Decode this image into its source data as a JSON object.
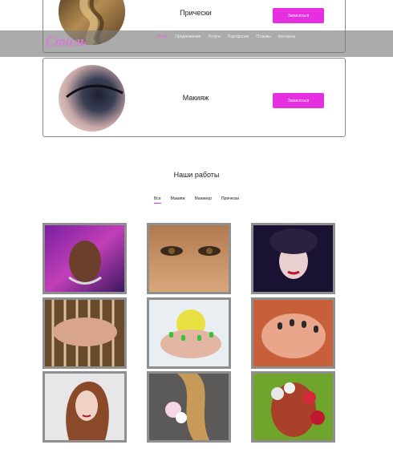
{
  "cards": [
    {
      "title": "Прически",
      "button": "Записаться"
    },
    {
      "title": "Макияж",
      "button": "Записаться"
    }
  ],
  "header": {
    "logo": "Стиль",
    "nav": [
      {
        "label": "О нас",
        "active": true
      },
      {
        "label": "Предложения"
      },
      {
        "label": "Услуги"
      },
      {
        "label": "Портфолио"
      },
      {
        "label": "Отзывы"
      },
      {
        "label": "Контакты"
      }
    ]
  },
  "works": {
    "title": "Наши работы",
    "filters": [
      {
        "label": "Все",
        "active": true
      },
      {
        "label": "Макияж"
      },
      {
        "label": "Маникюр"
      },
      {
        "label": "Прически"
      }
    ]
  },
  "colors": {
    "accent": "#e52fe0",
    "navbar": "#787878"
  },
  "gallery": [
    {
      "name": "makeup-photo-1"
    },
    {
      "name": "makeup-photo-2"
    },
    {
      "name": "makeup-photo-3"
    },
    {
      "name": "manicure-photo-1"
    },
    {
      "name": "manicure-photo-2"
    },
    {
      "name": "manicure-photo-3"
    },
    {
      "name": "hairstyle-photo-1"
    },
    {
      "name": "hairstyle-photo-2"
    },
    {
      "name": "hairstyle-photo-3"
    }
  ]
}
